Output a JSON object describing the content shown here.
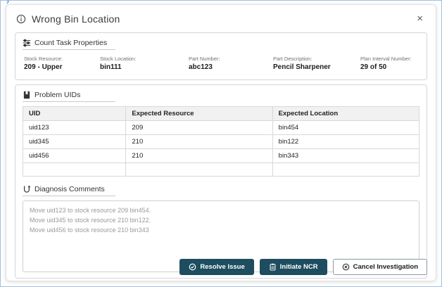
{
  "page": {
    "partial_text": "y"
  },
  "modal": {
    "title": "Wrong Bin Location",
    "close_icon": "×"
  },
  "count_task": {
    "title": "Count Task Properties",
    "fields": [
      {
        "label": "Stock Resource:",
        "value": "209 - Upper"
      },
      {
        "label": "Stock Location:",
        "value": "bin111"
      },
      {
        "label": "Part Number:",
        "value": "abc123"
      },
      {
        "label": "Part Description:",
        "value": "Pencil Sharpener"
      },
      {
        "label": "Plan Interval Number:",
        "value": "29 of 50"
      }
    ]
  },
  "problem_uids": {
    "title": "Problem UIDs",
    "columns": [
      "UID",
      "Expected Resource",
      "Expected Location"
    ],
    "rows": [
      [
        "uid123",
        "209",
        "bin454"
      ],
      [
        "uid345",
        "210",
        "bin122"
      ],
      [
        "uid456",
        "210",
        "bin343"
      ],
      [
        "",
        "",
        ""
      ]
    ]
  },
  "diagnosis": {
    "title": "Diagnosis Comments",
    "comments": "Move uid123 to stock resource 209 bin454.\nMove uid345 to stock resource 210 bin122.\nMove uid456 to stock resource 210 bin343"
  },
  "footer": {
    "resolve_label": "Resolve Issue",
    "ncr_label": "Initiate NCR",
    "cancel_label": "Cancel Investigation"
  },
  "colors": {
    "primary_button": "#1d4d5f",
    "table_header_bg": "#f1f1f1",
    "page_border": "#9fc1e4"
  }
}
